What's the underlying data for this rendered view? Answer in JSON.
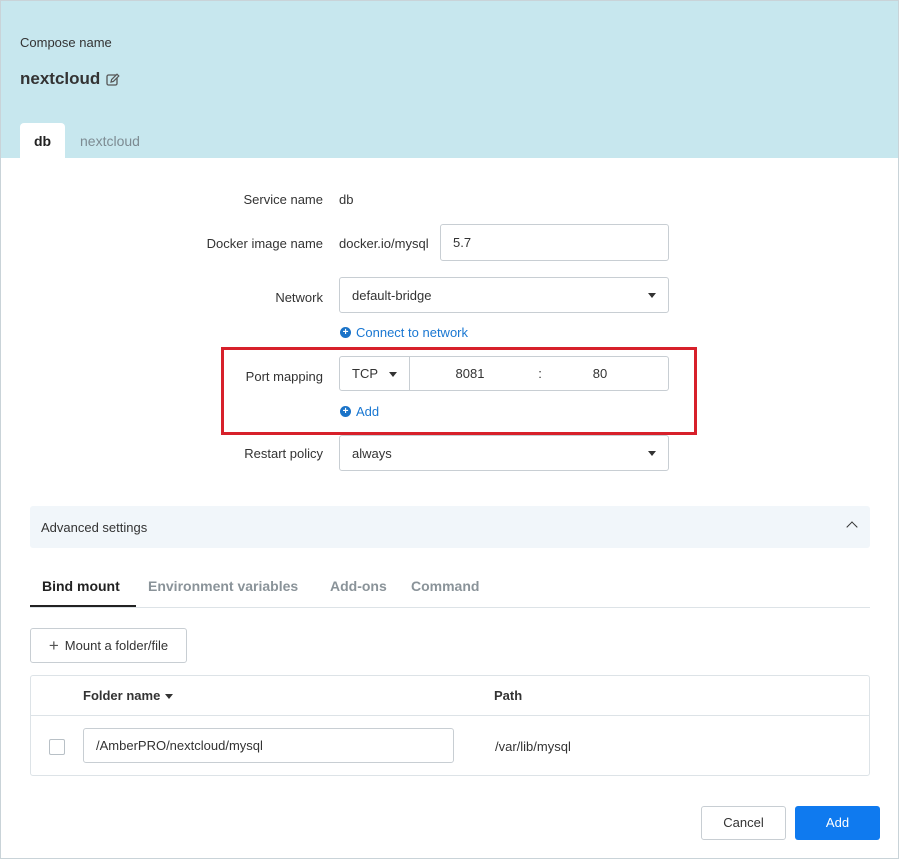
{
  "header": {
    "compose_label": "Compose name",
    "compose_name": "nextcloud"
  },
  "tabs": [
    {
      "label": "db",
      "active": true
    },
    {
      "label": "nextcloud",
      "active": false
    }
  ],
  "form": {
    "service_name_label": "Service name",
    "service_name_value": "db",
    "image_label": "Docker image name",
    "image_repo": "docker.io/mysql",
    "image_tag": "5.7",
    "network_label": "Network",
    "network_value": "default-bridge",
    "connect_network_link": "Connect to network",
    "port_label": "Port mapping",
    "port_protocol": "TCP",
    "port_host": "8081",
    "port_separator": ":",
    "port_container": "80",
    "port_add_link": "Add",
    "restart_label": "Restart policy",
    "restart_value": "always"
  },
  "advanced": {
    "label": "Advanced settings",
    "expanded": true
  },
  "subtabs": [
    {
      "label": "Bind mount",
      "active": true
    },
    {
      "label": "Environment variables",
      "active": false
    },
    {
      "label": "Add-ons",
      "active": false
    },
    {
      "label": "Command",
      "active": false
    }
  ],
  "mount_button": "Mount a folder/file",
  "table": {
    "columns": [
      "Folder name",
      "Path"
    ],
    "rows": [
      {
        "folder": "/AmberPRO/nextcloud/mysql",
        "path": "/var/lib/mysql",
        "checked": false
      }
    ]
  },
  "footer": {
    "cancel": "Cancel",
    "add": "Add"
  },
  "colors": {
    "header_bg": "#c7e7ee",
    "primary": "#0f7aef",
    "link": "#1977d2",
    "highlight": "#d7202a"
  }
}
